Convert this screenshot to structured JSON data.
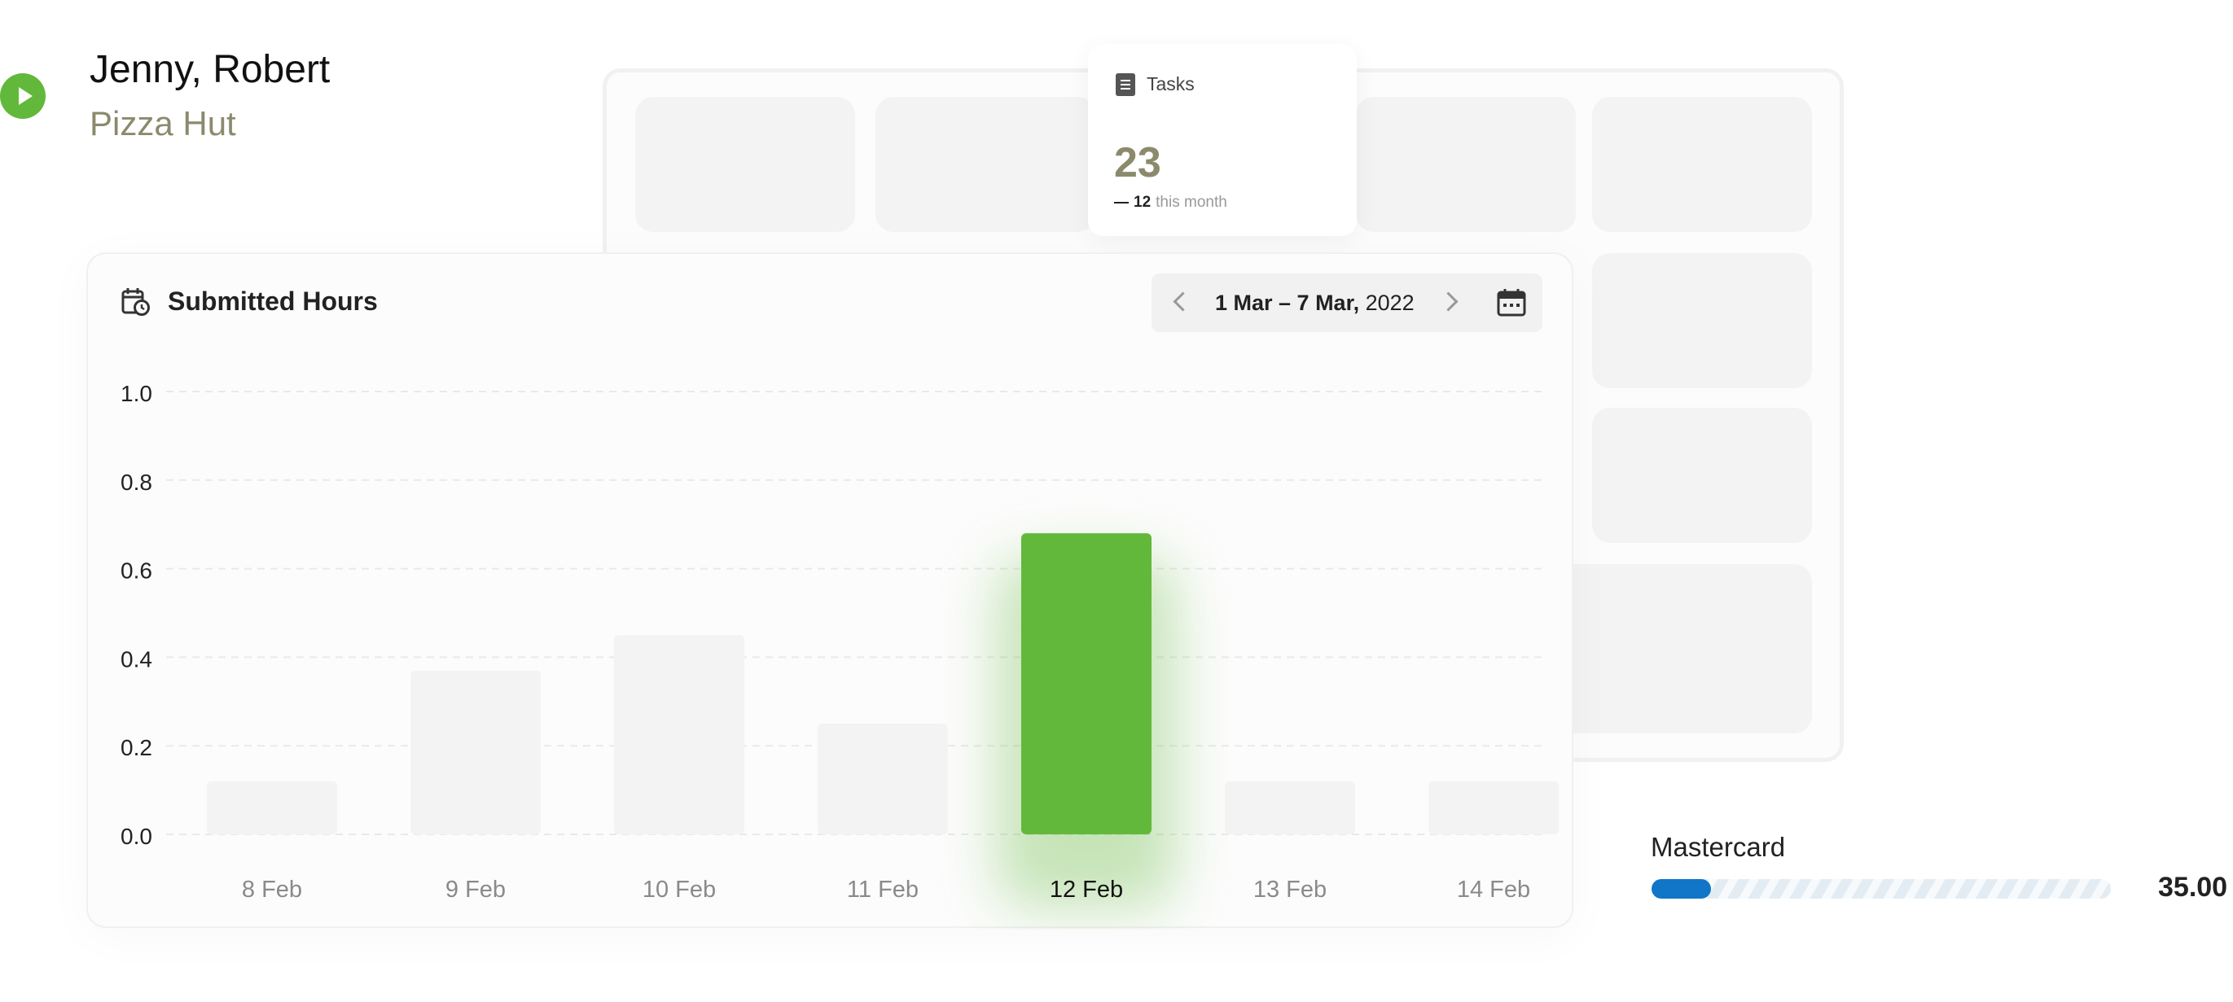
{
  "profile": {
    "name": "Jenny, Robert",
    "company": "Pizza Hut",
    "play_icon": "play-icon"
  },
  "tasks_card": {
    "label": "Tasks",
    "icon": "document-icon",
    "value": "23",
    "delta_value": "12",
    "delta_text": "this month"
  },
  "hours_card": {
    "title": "Submitted Hours",
    "icon": "calendar-clock-icon",
    "date_range_bold": "1 Mar – 7 Mar,",
    "date_range_year": " 2022",
    "prev_icon": "chevron-left-icon",
    "next_icon": "chevron-right-icon",
    "calendar_icon": "calendar-icon"
  },
  "chart_data": {
    "type": "bar",
    "title": "",
    "xlabel": "",
    "ylabel": "",
    "categories": [
      "8 Feb",
      "9 Feb",
      "10 Feb",
      "11 Feb",
      "12 Feb",
      "13 Feb",
      "14 Feb"
    ],
    "values": [
      0.12,
      0.37,
      0.45,
      0.25,
      0.68,
      0.12,
      0.12
    ],
    "highlighted_category": "12 Feb",
    "ylim": [
      0,
      1
    ],
    "yticks": [
      "0.0",
      "0.2",
      "0.4",
      "0.6",
      "0.8",
      "1.0"
    ],
    "grid": true,
    "colors": {
      "highlight": "#62b83b",
      "muted": "#f3f3f3"
    }
  },
  "payment": {
    "label": "Mastercard",
    "value": "35.00",
    "progress_fraction": 0.13,
    "color": "#1176c8"
  }
}
